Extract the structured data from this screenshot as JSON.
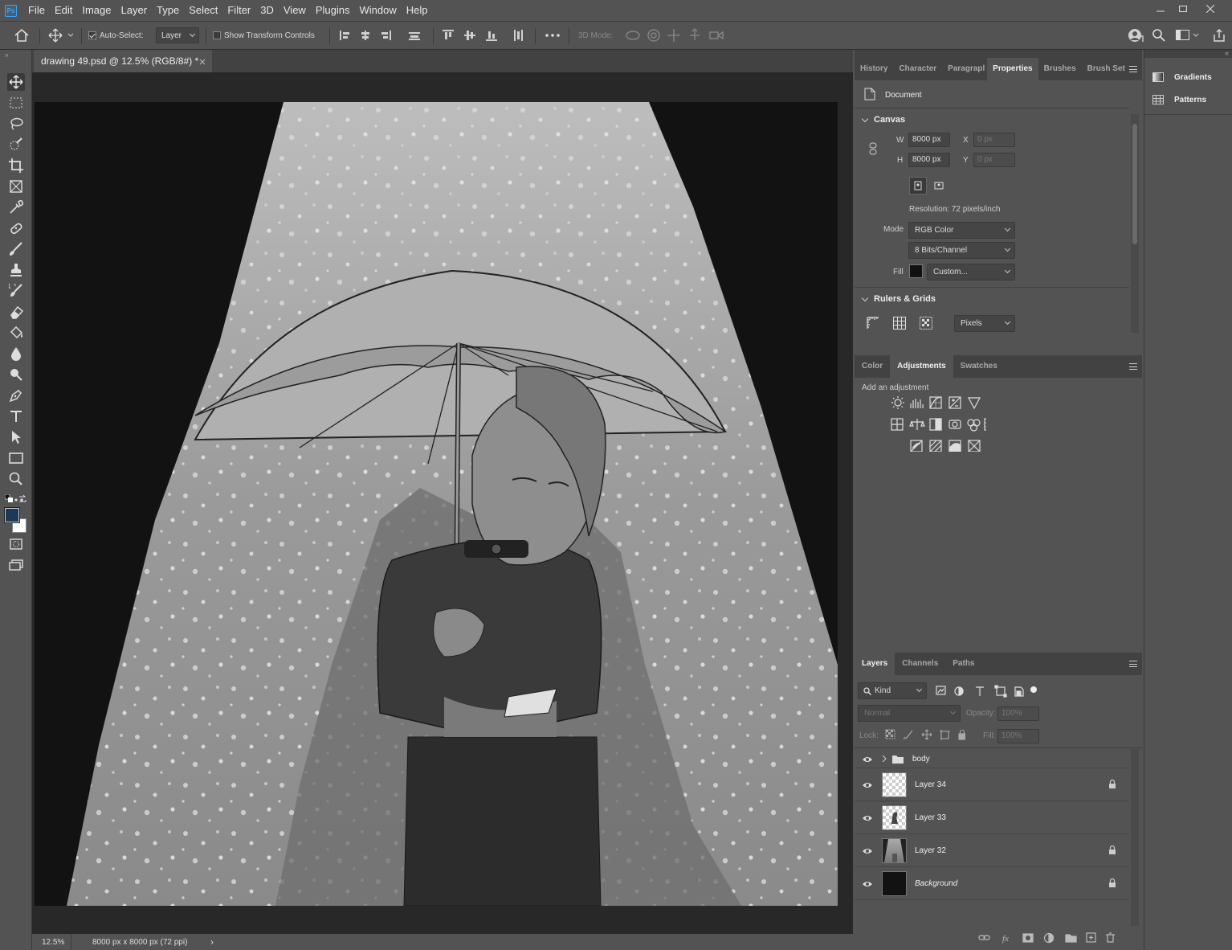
{
  "menubar": {
    "logo": "Ps",
    "items": [
      "File",
      "Edit",
      "Image",
      "Layer",
      "Type",
      "Select",
      "Filter",
      "3D",
      "View",
      "Plugins",
      "Window",
      "Help"
    ]
  },
  "options": {
    "auto_select_label": "Auto-Select:",
    "auto_select_checked": true,
    "auto_select_target": "Layer",
    "show_transform_label": "Show Transform Controls",
    "show_transform_checked": false,
    "mode_3d_label": "3D Mode:"
  },
  "document": {
    "tab_title": "drawing 49.psd @ 12.5% (RGB/8#) *",
    "zoom": "12.5%",
    "doc_info": "8000 px x 8000 px (72 ppi)"
  },
  "properties_panel": {
    "tabs": [
      "History",
      "Character",
      "Paragrapl",
      "Properties",
      "Brushes",
      "Brush Set"
    ],
    "active_tab": "Properties",
    "doc_label": "Document",
    "canvas_section": "Canvas",
    "w_label": "W",
    "w_value": "8000 px",
    "h_label": "H",
    "h_value": "8000 px",
    "x_label": "X",
    "x_placeholder": "0 px",
    "y_label": "Y",
    "y_placeholder": "0 px",
    "resolution": "Resolution: 72 pixels/inch",
    "mode_label": "Mode",
    "mode_value": "RGB Color",
    "bits_value": "8 Bits/Channel",
    "fill_label": "Fill",
    "fill_value": "Custom...",
    "rulers_section": "Rulers & Grids",
    "units_value": "Pixels"
  },
  "adjustments_panel": {
    "tabs": [
      "Color",
      "Adjustments",
      "Swatches"
    ],
    "active_tab": "Adjustments",
    "hint": "Add an adjustment"
  },
  "layers_panel": {
    "tabs": [
      "Layers",
      "Channels",
      "Paths"
    ],
    "active_tab": "Layers",
    "filter_kind": "Kind",
    "blend_mode": "Normal",
    "opacity_label": "Opacity:",
    "opacity_value": "100%",
    "lock_label": "Lock:",
    "fill_label": "Fill:",
    "fill_value": "100%",
    "layers": [
      {
        "name": "body",
        "type": "group",
        "visible": true,
        "locked": false
      },
      {
        "name": "Layer 34",
        "type": "layer",
        "visible": true,
        "locked": true
      },
      {
        "name": "Layer 33",
        "type": "layer",
        "visible": true,
        "locked": false
      },
      {
        "name": "Layer 32",
        "type": "layer",
        "visible": true,
        "locked": true
      },
      {
        "name": "Background",
        "type": "background",
        "visible": true,
        "locked": true
      }
    ]
  },
  "right_panel": {
    "items": [
      "Gradients",
      "Patterns"
    ]
  },
  "colors": {
    "ui_bg": "#535353",
    "canvas_bg": "#282828",
    "foreground": "#1c3a57",
    "background": "#ffffff"
  }
}
